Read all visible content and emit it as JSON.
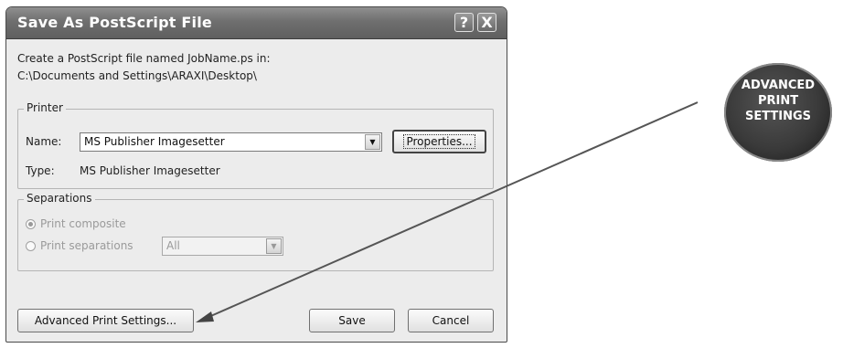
{
  "dialog": {
    "title": "Save As PostScript File",
    "help_glyph": "?",
    "close_glyph": "X",
    "description_line1": "Create a PostScript file named JobName.ps in:",
    "description_line2": "C:\\Documents and Settings\\ARAXI\\Desktop\\"
  },
  "printer": {
    "legend": "Printer",
    "name_label": "Name:",
    "name_value": "MS Publisher Imagesetter",
    "properties_button": "Properties...",
    "type_label": "Type:",
    "type_value": "MS Publisher Imagesetter"
  },
  "separations": {
    "legend": "Separations",
    "option_composite": "Print composite",
    "option_separations": "Print separations",
    "separations_value": "All",
    "selected": "Print composite"
  },
  "buttons": {
    "advanced": "Advanced Print Settings...",
    "save": "Save",
    "cancel": "Cancel"
  },
  "callout": {
    "line1": "ADVANCED",
    "line2": "PRINT",
    "line3": "SETTINGS"
  }
}
